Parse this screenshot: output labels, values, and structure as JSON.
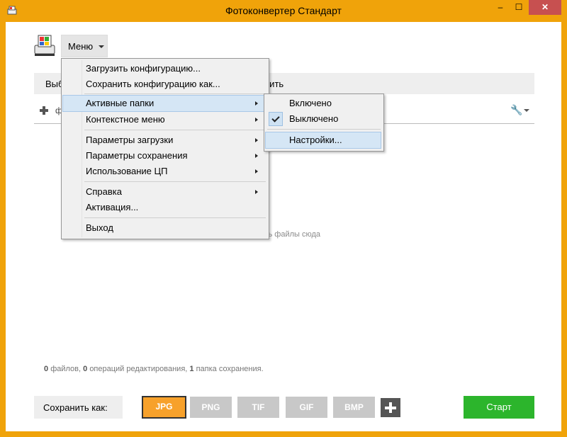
{
  "window": {
    "title": "Фотоконвертер Стандарт",
    "min_label": "–",
    "max_label": "☐",
    "close_label": "✕"
  },
  "menu_button": {
    "label": "Меню"
  },
  "toolbar": {
    "left_text": "Выб",
    "right_text": "нить"
  },
  "files": {
    "add_label": "ф",
    "drop_hint": "добавь файлы сюда"
  },
  "status": {
    "files_count": "0",
    "files_text": "файлов,",
    "ops_count": "0",
    "ops_text": "операций редактирования,",
    "folders_count": "1",
    "folders_text": "папка сохранения."
  },
  "save": {
    "label": "Сохранить как:",
    "formats": [
      "JPG",
      "PNG",
      "TIF",
      "GIF",
      "BMP"
    ],
    "active_format": "JPG",
    "start_label": "Старт"
  },
  "main_menu": {
    "load_config": "Загрузить конфигурацию...",
    "save_config": "Сохранить конфигурацию как...",
    "active_folders": "Активные папки",
    "context_menu": "Контекстное меню",
    "load_params": "Параметры загрузки",
    "save_params": "Параметры сохранения",
    "cpu_usage": "Использование ЦП",
    "help": "Справка",
    "activation": "Активация...",
    "exit": "Выход"
  },
  "sub_menu": {
    "enabled": "Включено",
    "disabled": "Выключено",
    "settings": "Настройки..."
  },
  "colors": {
    "titlebar": "#f0a30a",
    "active_format": "#f7a12b",
    "start": "#2cb52c",
    "highlight": "#d5e6f5"
  }
}
